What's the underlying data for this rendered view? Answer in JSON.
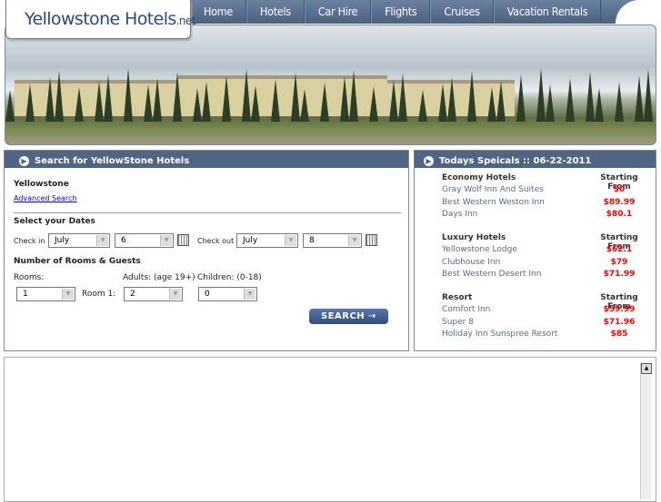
{
  "logo": {
    "main": "Yellowstone Hotels",
    "suffix": ".net"
  },
  "nav": [
    "Home",
    "Hotels",
    "Car Hire",
    "Flights",
    "Cruises",
    "Vacation Rentals"
  ],
  "search": {
    "title": "Search for YellowStone Hotels",
    "location": "Yellowstone",
    "advanced_link": "Advanced Search",
    "dates_heading": "Select your Dates",
    "checkin_label": "Check in",
    "checkin_month": "July",
    "checkin_day": "6",
    "checkout_label": "Check out",
    "checkout_month": "July",
    "checkout_day": "8",
    "rooms_heading": "Number of Rooms & Guests",
    "rooms_label": "Rooms:",
    "adults_label": "Adults: (age 19+)",
    "children_label": "Children: (0-18)",
    "rooms_value": "1",
    "room1_label": "Room 1:",
    "adults_value": "2",
    "children_value": "0",
    "search_button": "SEARCH"
  },
  "specials": {
    "title": "Todays Speicals :: 06-22-2011",
    "groups": [
      {
        "heading": "Economy Hotels",
        "price_heading": "Starting From",
        "items": [
          {
            "name": "Gray Wolf Inn And Suites",
            "price": "$0"
          },
          {
            "name": "Best Western Weston Inn",
            "price": "$89.99"
          },
          {
            "name": "Days Inn",
            "price": "$80.1"
          }
        ]
      },
      {
        "heading": "Luxury Hotels",
        "price_heading": "Starting From",
        "items": [
          {
            "name": "Yellowstone Lodge",
            "price": "$62.1"
          },
          {
            "name": "Clubhouse Inn",
            "price": "$79"
          },
          {
            "name": "Best Western Desert Inn",
            "price": "$71.99"
          }
        ]
      },
      {
        "heading": "Resort",
        "price_heading": "Starting From",
        "items": [
          {
            "name": "Comfort Inn",
            "price": "$59.99"
          },
          {
            "name": "Super 8",
            "price": "$71.96"
          },
          {
            "name": "Holiday Inn Sunspree Resort",
            "price": "$85"
          }
        ]
      }
    ]
  },
  "colors": {
    "nav": "#4b6282",
    "panel_header": "#4f6585",
    "price": "#ff0000",
    "hotel_link": "#556a8a"
  }
}
